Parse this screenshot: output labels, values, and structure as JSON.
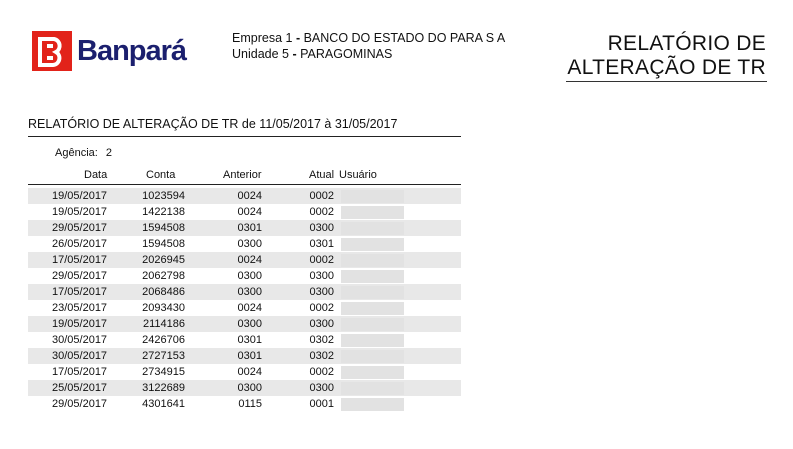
{
  "header": {
    "logo_text": "Banpará",
    "empresa_label": "Empresa 1",
    "empresa_name": "BANCO DO ESTADO DO PARA S A",
    "unidade_label": "Unidade 5",
    "unidade_name": "PARAGOMINAS",
    "title_line1": "RELATÓRIO DE",
    "title_line2": "ALTERAÇÃO DE TR",
    "colors": {
      "logo_red": "#e2231a",
      "logo_blue": "#1b1f6e"
    }
  },
  "report": {
    "subtitle": "RELATÓRIO DE ALTERAÇÃO DE TR de 11/05/2017 à 31/05/2017",
    "agencia_label": "Agência:",
    "agencia_value": "2"
  },
  "table": {
    "columns": [
      "Data",
      "Conta",
      "Anterior",
      "Atual",
      "Usuário"
    ],
    "rows": [
      {
        "data": "19/05/2017",
        "conta": "1023594",
        "anterior": "0024",
        "atual": "0002"
      },
      {
        "data": "19/05/2017",
        "conta": "1422138",
        "anterior": "0024",
        "atual": "0002"
      },
      {
        "data": "29/05/2017",
        "conta": "1594508",
        "anterior": "0301",
        "atual": "0300"
      },
      {
        "data": "26/05/2017",
        "conta": "1594508",
        "anterior": "0300",
        "atual": "0301"
      },
      {
        "data": "17/05/2017",
        "conta": "2026945",
        "anterior": "0024",
        "atual": "0002"
      },
      {
        "data": "29/05/2017",
        "conta": "2062798",
        "anterior": "0300",
        "atual": "0300"
      },
      {
        "data": "17/05/2017",
        "conta": "2068486",
        "anterior": "0300",
        "atual": "0300"
      },
      {
        "data": "23/05/2017",
        "conta": "2093430",
        "anterior": "0024",
        "atual": "0002"
      },
      {
        "data": "19/05/2017",
        "conta": "2114186",
        "anterior": "0300",
        "atual": "0300"
      },
      {
        "data": "30/05/2017",
        "conta": "2426706",
        "anterior": "0301",
        "atual": "0302"
      },
      {
        "data": "30/05/2017",
        "conta": "2727153",
        "anterior": "0301",
        "atual": "0302"
      },
      {
        "data": "17/05/2017",
        "conta": "2734915",
        "anterior": "0024",
        "atual": "0002"
      },
      {
        "data": "25/05/2017",
        "conta": "3122689",
        "anterior": "0300",
        "atual": "0300"
      },
      {
        "data": "29/05/2017",
        "conta": "4301641",
        "anterior": "0115",
        "atual": "0001"
      }
    ]
  }
}
